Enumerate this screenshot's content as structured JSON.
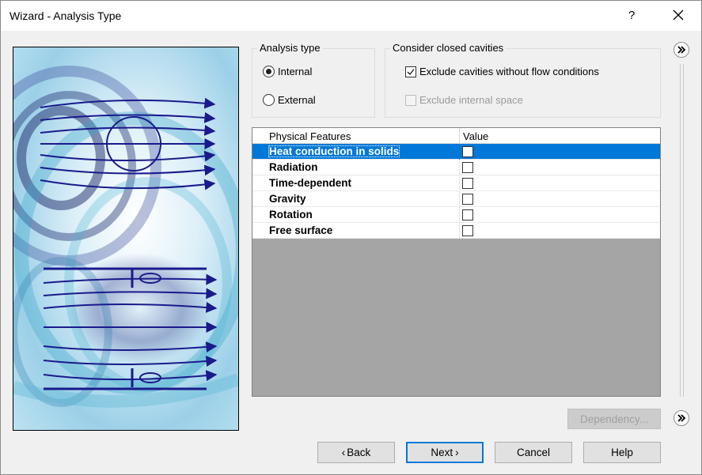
{
  "window": {
    "title": "Wizard - Analysis Type",
    "help_label": "?",
    "close_icon": "close-icon"
  },
  "analysis_type": {
    "legend": "Analysis type",
    "options": [
      {
        "label": "Internal",
        "selected": true
      },
      {
        "label": "External",
        "selected": false
      }
    ]
  },
  "cavities": {
    "legend": "Consider closed cavities",
    "options": [
      {
        "label": "Exclude cavities without flow conditions",
        "checked": true,
        "enabled": true
      },
      {
        "label": "Exclude internal space",
        "checked": false,
        "enabled": false
      }
    ]
  },
  "grid": {
    "headers": [
      "Physical Features",
      "Value"
    ],
    "rows": [
      {
        "label": "Heat conduction in solids",
        "checked": false,
        "selected": true
      },
      {
        "label": "Radiation",
        "checked": false,
        "selected": false
      },
      {
        "label": "Time-dependent",
        "checked": false,
        "selected": false
      },
      {
        "label": "Gravity",
        "checked": false,
        "selected": false
      },
      {
        "label": "Rotation",
        "checked": false,
        "selected": false
      },
      {
        "label": "Free surface",
        "checked": false,
        "selected": false
      }
    ]
  },
  "dependency_label": "Dependency...",
  "buttons": {
    "back": "Back",
    "next": "Next",
    "cancel": "Cancel",
    "help": "Help"
  },
  "colors": {
    "selection": "#0078d7",
    "flow_lines": "#1a1a8c",
    "grid_empty": "#a5a5a5"
  }
}
